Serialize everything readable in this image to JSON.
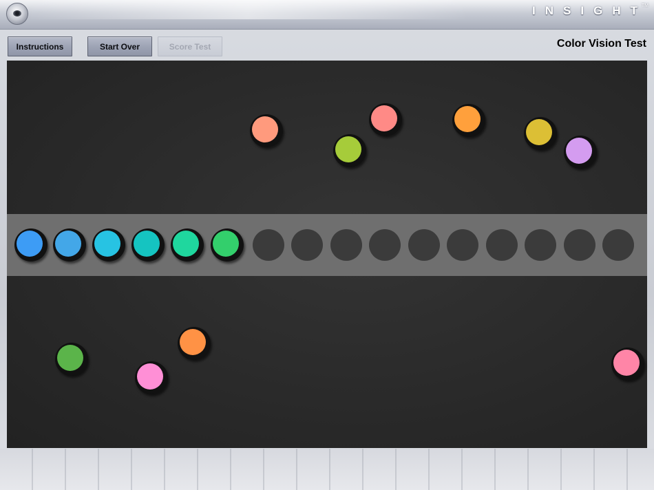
{
  "header": {
    "brand": "INSIGHT",
    "brand_tm": "TM"
  },
  "toolbar": {
    "instructions_label": "Instructions",
    "start_over_label": "Start Over",
    "score_test_label": "Score Test"
  },
  "page_title": "Color Vision Test",
  "placed_caps": [
    {
      "color": "#3d9cf5"
    },
    {
      "color": "#43a7e8"
    },
    {
      "color": "#27c3e3"
    },
    {
      "color": "#15c4c1"
    },
    {
      "color": "#1fd79e"
    },
    {
      "color": "#33cf6c"
    }
  ],
  "loose_caps": [
    {
      "color": "#ff9a7d"
    },
    {
      "color": "#a6cc3a"
    },
    {
      "color": "#ff8a86"
    },
    {
      "color": "#ffa03c"
    },
    {
      "color": "#dcbf35"
    },
    {
      "color": "#d49cf0"
    },
    {
      "color": "#5bb44a"
    },
    {
      "color": "#ff9245"
    },
    {
      "color": "#ff8fd6"
    },
    {
      "color": "#ff85a7"
    }
  ],
  "empty_slots": 10
}
